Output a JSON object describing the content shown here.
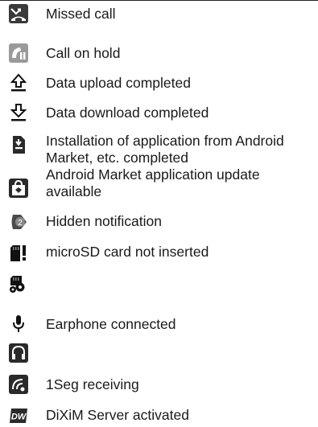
{
  "rows": [
    {
      "icon": "missed-call-icon",
      "text": "Missed call"
    },
    {
      "icon": "call-on-hold-icon",
      "text": "Call on hold"
    },
    {
      "icon": "upload-arrow-icon",
      "text": "Data upload completed"
    },
    {
      "icon": "download-arrow-icon",
      "text": "Data download completed"
    },
    {
      "icon": "app-install-icon",
      "text": "Installation of application from Android Market, etc. completed"
    },
    {
      "icon": "market-bag-icon",
      "text": "Android Market application update available"
    },
    {
      "icon": "hidden-notification-icon",
      "text": "Hidden notification",
      "badge": "2"
    },
    {
      "icon": "sd-card-missing-icon",
      "text": "microSD card not inserted"
    },
    {
      "icon": "sd-card-settings-icon",
      "text": ""
    },
    {
      "icon": "microphone-icon",
      "text": "Earphone connected"
    },
    {
      "icon": "headphones-icon",
      "text": ""
    },
    {
      "icon": "oneseg-signal-icon",
      "text": "1Seg receiving"
    },
    {
      "icon": "dixim-icon",
      "text": "DiXiM Server activated",
      "badge": "DW"
    }
  ]
}
